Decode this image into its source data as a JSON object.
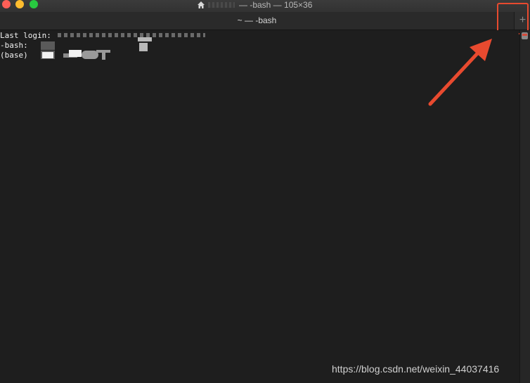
{
  "window": {
    "title": "— -bash — 105×36",
    "tab_title": "~ — -bash",
    "new_tab_symbol": "+"
  },
  "icons": {
    "title_icon": "home-icon",
    "new_tab": "plus-icon",
    "annotation": "red-arrow-icon"
  },
  "terminal": {
    "line1": "Last login:",
    "line2": "-bash:",
    "line3": "(base)"
  },
  "colors": {
    "annotation": "#e84a2f",
    "background": "#1e1e1e",
    "close": "#fe5f57",
    "minimize": "#febc2e",
    "zoom": "#28c840"
  },
  "watermark": "https://blog.csdn.net/weixin_44037416"
}
